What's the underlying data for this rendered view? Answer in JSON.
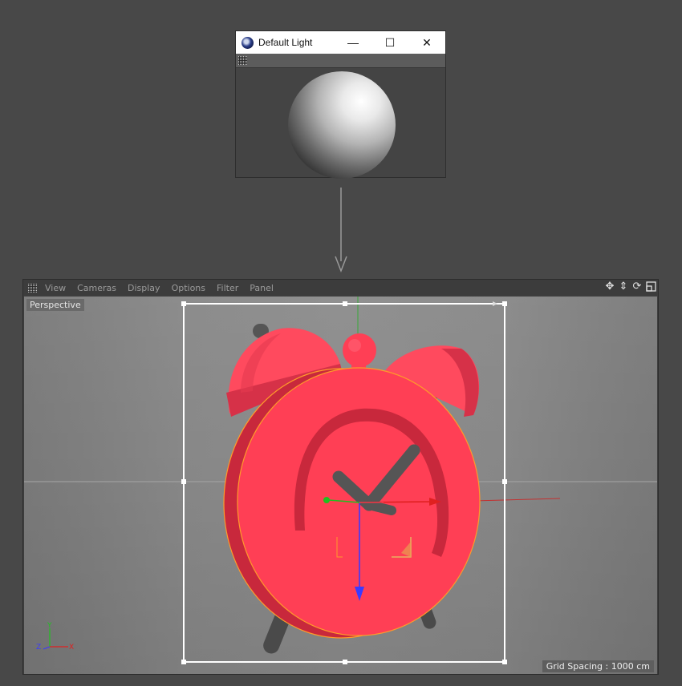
{
  "default_light_window": {
    "title": "Default Light",
    "controls": {
      "minimize": "—",
      "maximize": "☐",
      "close": "✕"
    }
  },
  "viewport": {
    "menu": [
      "View",
      "Cameras",
      "Display",
      "Options",
      "Filter",
      "Panel"
    ],
    "camera_label": "Perspective",
    "grid_spacing": "Grid Spacing : 1000 cm",
    "nav_icons": [
      "move-icon",
      "dolly-icon",
      "rotate-icon",
      "maximize-view-icon"
    ],
    "axis_labels": {
      "y": "Y",
      "z": "Z",
      "x": "X"
    }
  },
  "colors": {
    "clock_body": "#ff3f55",
    "clock_shadow": "#c8283c",
    "legs": "#4a4a4a",
    "axis_x": "#e02020",
    "axis_y": "#20c020",
    "axis_z": "#2040ff",
    "selection_outline": "#ff9a2a"
  }
}
